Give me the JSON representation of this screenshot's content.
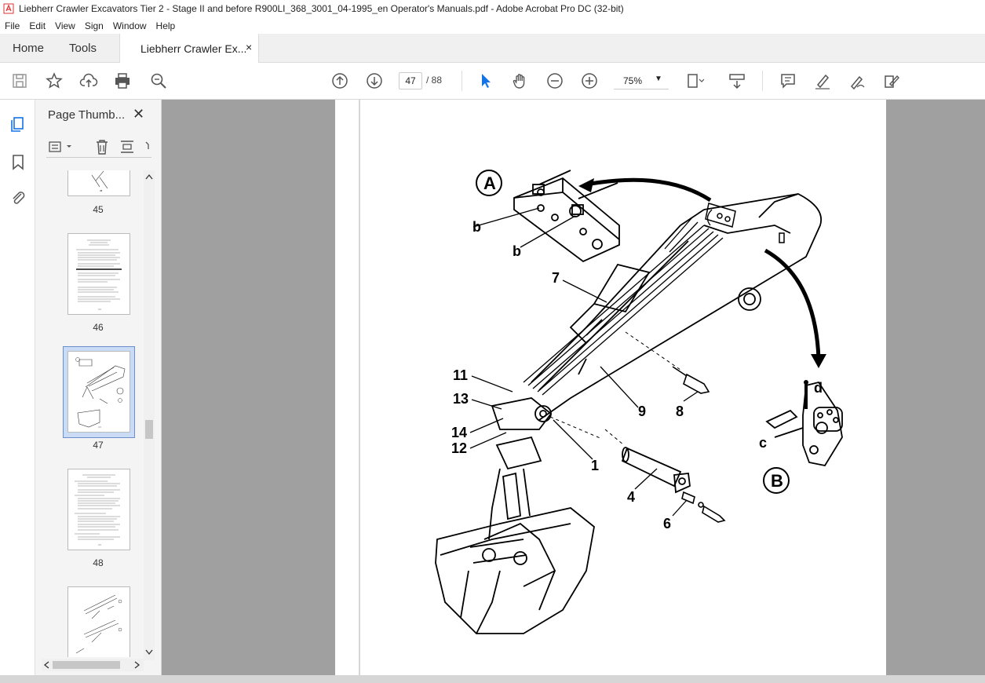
{
  "window": {
    "title": "Liebherr Crawler Excavators Tier 2 - Stage II and before  R900LI_368_3001_04-1995_en Operator's Manuals.pdf - Adobe Acrobat Pro DC (32-bit)"
  },
  "menu": [
    "File",
    "Edit",
    "View",
    "Sign",
    "Window",
    "Help"
  ],
  "tabs": {
    "home": "Home",
    "tools": "Tools",
    "document": "Liebherr Crawler Ex...",
    "close": "×"
  },
  "toolbar": {
    "page_current": "47",
    "page_total": "/ 88",
    "zoom": "75%"
  },
  "panel": {
    "title": "Page Thumb...",
    "close": "✕",
    "thumbnails": [
      {
        "label": "45"
      },
      {
        "label": "46"
      },
      {
        "label": "47",
        "selected": true
      },
      {
        "label": "48"
      },
      {
        "label": ""
      }
    ]
  },
  "diagram": {
    "callouts": [
      "A",
      "B",
      "b",
      "b",
      "7",
      "11",
      "13",
      "14",
      "12",
      "1",
      "9",
      "8",
      "4",
      "6",
      "d",
      "c"
    ]
  },
  "colors": {
    "accent": "#1473e6",
    "selected_thumb": "#c9dbf5",
    "viewport": "#a0a0a0"
  }
}
